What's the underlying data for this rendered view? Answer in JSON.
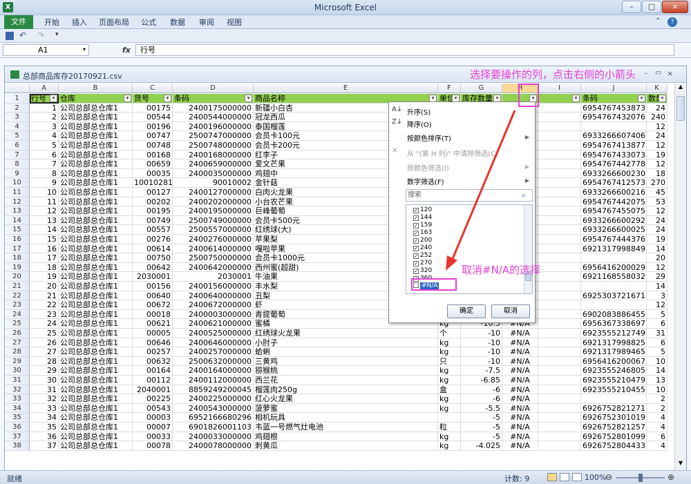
{
  "window": {
    "title": "Microsoft Excel",
    "minimize": "–",
    "maximize": "□",
    "close": "×"
  },
  "ribbon": {
    "file": "文件",
    "tabs": [
      "开始",
      "插入",
      "页面布局",
      "公式",
      "数据",
      "审阅",
      "视图"
    ]
  },
  "formula_bar": {
    "name_box": "A1",
    "fx": "fx",
    "content": "行号"
  },
  "workbook": {
    "title": "总部商品库存20170921.csv"
  },
  "columns": [
    "A",
    "B",
    "C",
    "D",
    "E",
    "F",
    "G",
    "H",
    "I",
    "J",
    "K"
  ],
  "header_row": [
    "行号",
    "仓库",
    "货号",
    "条码",
    "商品名称",
    "单位",
    "库存数量",
    "",
    "",
    "条码",
    "数量"
  ],
  "rows": [
    [
      "1",
      "公司总部总仓库1",
      "00175",
      "2400175000000",
      "新疆小白杏",
      "",
      "",
      "",
      "",
      "6954767453873",
      "24"
    ],
    [
      "2",
      "公司总部总仓库1",
      "00544",
      "2400544000000",
      "冠龙西瓜",
      "",
      "",
      "",
      "",
      "6954767432076",
      "240"
    ],
    [
      "3",
      "公司总部总仓库1",
      "00196",
      "2400196000000",
      "泰国榴莲",
      "",
      "",
      "",
      "",
      "",
      "12"
    ],
    [
      "4",
      "公司总部总仓库1",
      "00747",
      "2500747000000",
      "会员卡100元",
      "",
      "",
      "",
      "",
      "6933266607406",
      "24"
    ],
    [
      "5",
      "公司总部总仓库1",
      "00748",
      "2500748000000",
      "会员卡200元",
      "",
      "",
      "",
      "",
      "6954767413877",
      "12"
    ],
    [
      "6",
      "公司总部总仓库1",
      "00168",
      "2400168000000",
      "红李子",
      "",
      "",
      "",
      "",
      "6954767433073",
      "19"
    ],
    [
      "7",
      "公司总部总仓库1",
      "00659",
      "2400659000000",
      "爱文芒果",
      "",
      "",
      "",
      "",
      "6954767442778",
      "12"
    ],
    [
      "8",
      "公司总部总仓库1",
      "00035",
      "2400035000000",
      "鸡翅中",
      "",
      "",
      "",
      "",
      "6933266600230",
      "18"
    ],
    [
      "9",
      "公司总部总仓库1",
      "10010281",
      "90010002",
      "金针菇",
      "",
      "",
      "",
      "",
      "6954767412573",
      "270"
    ],
    [
      "10",
      "公司总部总仓库1",
      "00127",
      "2400127000000",
      "白肉火龙果",
      "",
      "",
      "",
      "",
      "6933266600216",
      "45"
    ],
    [
      "11",
      "公司总部总仓库1",
      "00202",
      "2400202000000",
      "小台农芒果",
      "",
      "",
      "",
      "",
      "6954767442075",
      "53"
    ],
    [
      "12",
      "公司总部总仓库1",
      "00195",
      "2400195000000",
      "巨峰葡萄",
      "",
      "",
      "",
      "",
      "6954767455075",
      "12"
    ],
    [
      "13",
      "公司总部总仓库1",
      "00749",
      "2500749000000",
      "会员卡500元",
      "",
      "",
      "",
      "",
      "6933266600292",
      "24"
    ],
    [
      "14",
      "公司总部总仓库1",
      "00557",
      "2500557000000",
      "红绣球(大)",
      "",
      "",
      "",
      "",
      "6933266600025",
      "24"
    ],
    [
      "15",
      "公司总部总仓库1",
      "00276",
      "2400276000000",
      "苹果梨",
      "",
      "",
      "",
      "",
      "6954767444376",
      "19"
    ],
    [
      "16",
      "公司总部总仓库1",
      "00614",
      "2400614000000",
      "嘎啦苹果",
      "",
      "",
      "",
      "",
      "6921317998849",
      "14"
    ],
    [
      "17",
      "公司总部总仓库1",
      "00750",
      "2500750000000",
      "会员卡1000元",
      "",
      "",
      "",
      "",
      "",
      "20"
    ],
    [
      "18",
      "公司总部总仓库1",
      "00642",
      "2400642000000",
      "西州蜜(超甜)",
      "",
      "",
      "",
      "",
      "6956416200029",
      "12"
    ],
    [
      "19",
      "公司总部总仓库1",
      "2030001",
      "2030001",
      "牛油果",
      "",
      "",
      "",
      "",
      "6921168558032",
      "29"
    ],
    [
      "20",
      "公司总部总仓库1",
      "00156",
      "2400156000000",
      "丰水梨",
      "",
      "",
      "",
      "",
      "",
      "14"
    ],
    [
      "21",
      "公司总部总仓库1",
      "00640",
      "2400640000000",
      "丑梨",
      "",
      "",
      "",
      "",
      "6925303721671",
      "3"
    ],
    [
      "22",
      "公司总部总仓库1",
      "00672",
      "2400672000000",
      "虾",
      "",
      "",
      "",
      "",
      "",
      "12"
    ],
    [
      "23",
      "公司总部总仓库1",
      "00018",
      "2400003000000",
      "青提葡萄",
      "",
      "",
      "",
      "",
      "6902083886455",
      "5"
    ],
    [
      "24",
      "公司总部总仓库1",
      "00621",
      "2400621000000",
      "蜜橘",
      "kg",
      "-10.5",
      "#N/A",
      "",
      "6956367338697",
      "6"
    ],
    [
      "25",
      "公司总部总仓库1",
      "00005",
      "2400525000000",
      "红绣球火龙果",
      "个",
      "-10",
      "#N/A",
      "",
      "6923555212749",
      "31"
    ],
    [
      "26",
      "公司总部总仓库1",
      "00646",
      "2400646000000",
      "小肘子",
      "kg",
      "-10",
      "#N/A",
      "",
      "6921317998825",
      "6"
    ],
    [
      "27",
      "公司总部总仓库1",
      "00257",
      "2400257000000",
      "蛤蜊",
      "kg",
      "-10",
      "#N/A",
      "",
      "6921317989465",
      "5"
    ],
    [
      "28",
      "公司总部总仓库1",
      "00632",
      "2500632000000",
      "三黄鸡",
      "只",
      "-10",
      "#N/A",
      "",
      "6956416200067",
      "10"
    ],
    [
      "29",
      "公司总部总仓库1",
      "00164",
      "2400164000000",
      "猕猴桃",
      "kg",
      "-7.5",
      "#N/A",
      "",
      "6923555246805",
      "14"
    ],
    [
      "30",
      "公司总部总仓库1",
      "00112",
      "2400112000000",
      "西兰花",
      "kg",
      "-6.85",
      "#N/A",
      "",
      "6923555210479",
      "13"
    ],
    [
      "31",
      "公司总部总仓库1",
      "2040001",
      "8859249200045",
      "榴莲肉250g",
      "盒",
      "-6",
      "#N/A",
      "",
      "6923555210455",
      "10"
    ],
    [
      "32",
      "公司总部总仓库1",
      "00225",
      "2400225000000",
      "红心火龙果",
      "kg",
      "-6",
      "#N/A",
      "",
      "",
      "2"
    ],
    [
      "33",
      "公司总部总仓库1",
      "00543",
      "2400543000000",
      "菠萝蜜",
      "kg",
      "-5.5",
      "#N/A",
      "",
      "6926752821271",
      "2"
    ],
    [
      "34",
      "公司总部总仓库1",
      "00003",
      "6952166680296",
      "相机玩具",
      "",
      "-5",
      "#N/A",
      "",
      "6926752301019",
      "4"
    ],
    [
      "35",
      "公司总部总仓库1",
      "00007",
      "6901826001103",
      "韦蓝一号燃气灶电池",
      "粒",
      "-5",
      "#N/A",
      "",
      "6926752821257",
      "4"
    ],
    [
      "36",
      "公司总部总仓库1",
      "00033",
      "2400033000000",
      "鸡翅根",
      "kg",
      "-5",
      "#N/A",
      "",
      "6926752801099",
      "6"
    ],
    [
      "37",
      "公司总部总仓库1",
      "00078",
      "2400078000000",
      "刺黄瓜",
      "kg",
      "-4.025",
      "#N/A",
      "",
      "6926752804433",
      "4"
    ]
  ],
  "filter_menu": {
    "sort_asc": "升序(S)",
    "sort_desc": "降序(O)",
    "sort_color": "按颜色排序(T)",
    "clear_filter": "从 \"(第 H 列)\" 中清除筛选(C)",
    "filter_color": "按颜色筛选(I)",
    "number_filter": "数字筛选(F)",
    "search_placeholder": "搜索",
    "items": [
      {
        "label": "120",
        "checked": true
      },
      {
        "label": "144",
        "checked": true
      },
      {
        "label": "159",
        "checked": true
      },
      {
        "label": "163",
        "checked": true
      },
      {
        "label": "200",
        "checked": true
      },
      {
        "label": "240",
        "checked": true
      },
      {
        "label": "252",
        "checked": true
      },
      {
        "label": "270",
        "checked": true
      },
      {
        "label": "320",
        "checked": true
      },
      {
        "label": "360",
        "checked": true
      },
      {
        "label": "#N/A",
        "checked": false
      }
    ],
    "ok": "确定",
    "cancel": "取消"
  },
  "annotations": {
    "top": "选择要操作的列，点击右侧的小箭头",
    "middle": "取消#N/A的选择",
    "color": "#e53fd6"
  },
  "status": {
    "ready": "就绪",
    "count": "计数: 9",
    "zoom": "100%"
  }
}
